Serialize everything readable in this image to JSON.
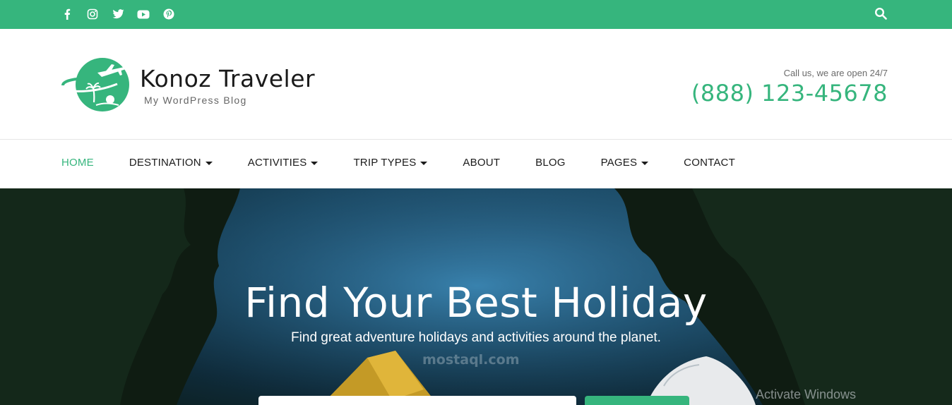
{
  "topbar": {
    "social_icons": [
      "facebook-icon",
      "instagram-icon",
      "twitter-icon",
      "youtube-icon",
      "pinterest-icon"
    ],
    "search_icon": "search-icon",
    "color": "#36b57d"
  },
  "header": {
    "site_title": "Konoz Traveler",
    "tagline": "My WordPress Blog",
    "call_text": "Call us, we are open 24/7",
    "phone": "(888) 123-45678"
  },
  "nav": {
    "items": [
      {
        "label": "HOME",
        "active": true,
        "dropdown": false
      },
      {
        "label": "DESTINATION",
        "active": false,
        "dropdown": true
      },
      {
        "label": "ACTIVITIES",
        "active": false,
        "dropdown": true
      },
      {
        "label": "TRIP TYPES",
        "active": false,
        "dropdown": true
      },
      {
        "label": "ABOUT",
        "active": false,
        "dropdown": false
      },
      {
        "label": "BLOG",
        "active": false,
        "dropdown": false
      },
      {
        "label": "PAGES",
        "active": false,
        "dropdown": true
      },
      {
        "label": "CONTACT",
        "active": false,
        "dropdown": false
      }
    ]
  },
  "hero": {
    "title": "Find Your Best Holiday",
    "subtitle": "Find great adventure holidays and activities around the planet.",
    "watermark": "mostaql.com",
    "overlay_text": "Activate Windows"
  },
  "colors": {
    "accent": "#36b57d",
    "text": "#1b1b1b"
  }
}
